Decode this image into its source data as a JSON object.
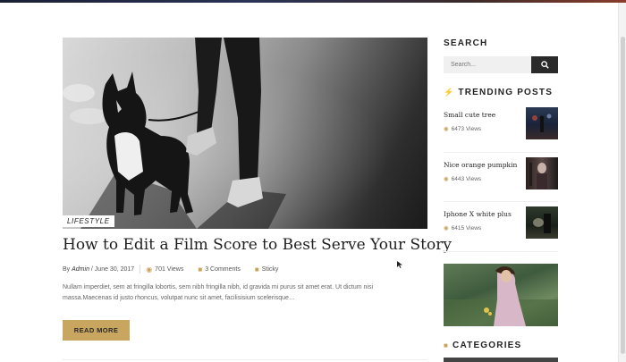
{
  "post": {
    "category": "LIFESTYLE",
    "title": "How to Edit a Film Score to Best Serve Your Story",
    "by": "By",
    "author": "Admin",
    "date": "/ June 30, 2017",
    "views": "701 Views",
    "comments": "3 Comments",
    "tag": "Sticky",
    "excerpt": "Nullam imperdiet, sem at fringilla lobortis, sem nibh fringilla nibh, id gravida mi purus sit amet erat. Ut dictum nisi massa.Maecenas id justo rhoncus, volutpat nunc sit amet, facilisisium scelerisque…",
    "read_more": "READ MORE"
  },
  "sidebar": {
    "search_heading": "SEARCH",
    "search_placeholder": "Search...",
    "trending_heading": "TRENDING POSTS",
    "trending": [
      {
        "title": "Small cute tree",
        "views": "6473 Views"
      },
      {
        "title": "Nice orange pumpkin",
        "views": "6443 Views"
      },
      {
        "title": "Iphone X white plus",
        "views": "6415 Views"
      }
    ],
    "categories_heading": "CATEGORIES"
  },
  "colors": {
    "accent": "#c9a660",
    "dark": "#2a2a2a"
  }
}
